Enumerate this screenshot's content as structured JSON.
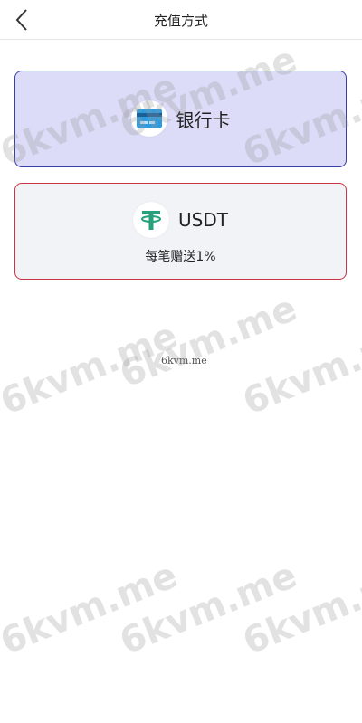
{
  "header": {
    "title": "充值方式",
    "back_icon": "chevron-left-icon"
  },
  "methods": [
    {
      "label": "银行卡",
      "icon": "bank-card-icon",
      "selected": true,
      "accent": "#3a3fa8",
      "background": "#dcdcf8"
    },
    {
      "label": "USDT",
      "icon": "tether-icon",
      "subtitle": "每笔赠送1%",
      "accent": "#cc3344",
      "background": "#f2f3f7"
    }
  ],
  "watermark": {
    "text": "6kvm.me",
    "small_text": "6kvm.me"
  }
}
